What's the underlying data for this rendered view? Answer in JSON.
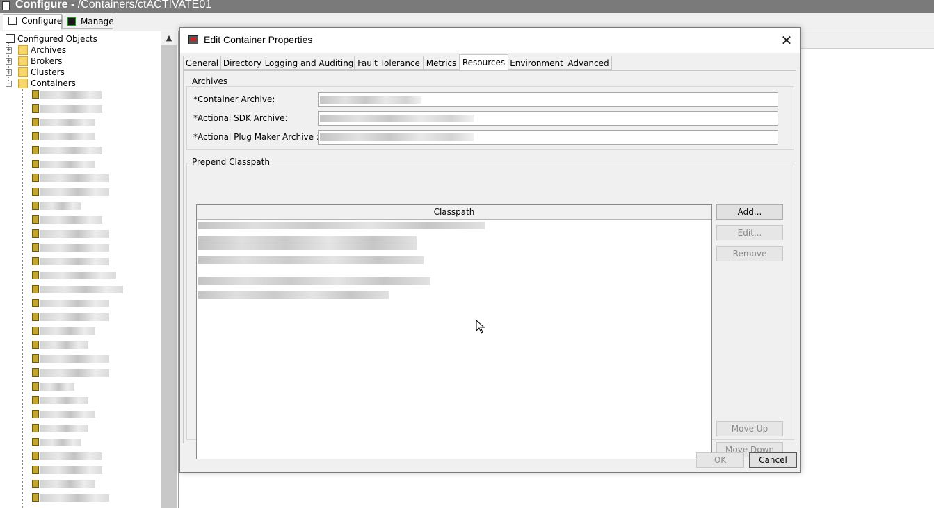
{
  "window": {
    "title_bold": "Configure - ",
    "title_path": "/Containers/ctACTIVATE01"
  },
  "top_tabs": [
    {
      "label": "Configure",
      "icon": "configure-icon"
    },
    {
      "label": "Manage",
      "icon": "manage-icon"
    }
  ],
  "tree": {
    "root_label": "Configured Objects",
    "nodes": [
      {
        "label": "Archives",
        "expander": "+"
      },
      {
        "label": "Brokers",
        "expander": "+"
      },
      {
        "label": "Clusters",
        "expander": "+"
      },
      {
        "label": "Containers",
        "expander": "-"
      }
    ],
    "scroll_up_glyph": "▲"
  },
  "dialog": {
    "title": "Edit Container Properties",
    "close_glyph": "✕",
    "tabs": [
      "General",
      "Directory",
      "Logging and Auditing",
      "Fault Tolerance",
      "Metrics",
      "Resources",
      "Environment",
      "Advanced"
    ],
    "active_tab": "Resources",
    "archives": {
      "group_label": "Archives",
      "container_archive_label": "*Container Archive:",
      "sdk_archive_label": "*Actional SDK Archive:",
      "plug_maker_archive_label": "*Actional Plug Maker Archive :"
    },
    "classpath": {
      "group_label": "Prepend Classpath",
      "column_header": "Classpath",
      "add_label": "Add...",
      "edit_label": "Edit...",
      "remove_label": "Remove",
      "move_up_label": "Move Up",
      "move_down_label": "Move Down"
    },
    "ok_label": "OK",
    "cancel_label": "Cancel"
  }
}
